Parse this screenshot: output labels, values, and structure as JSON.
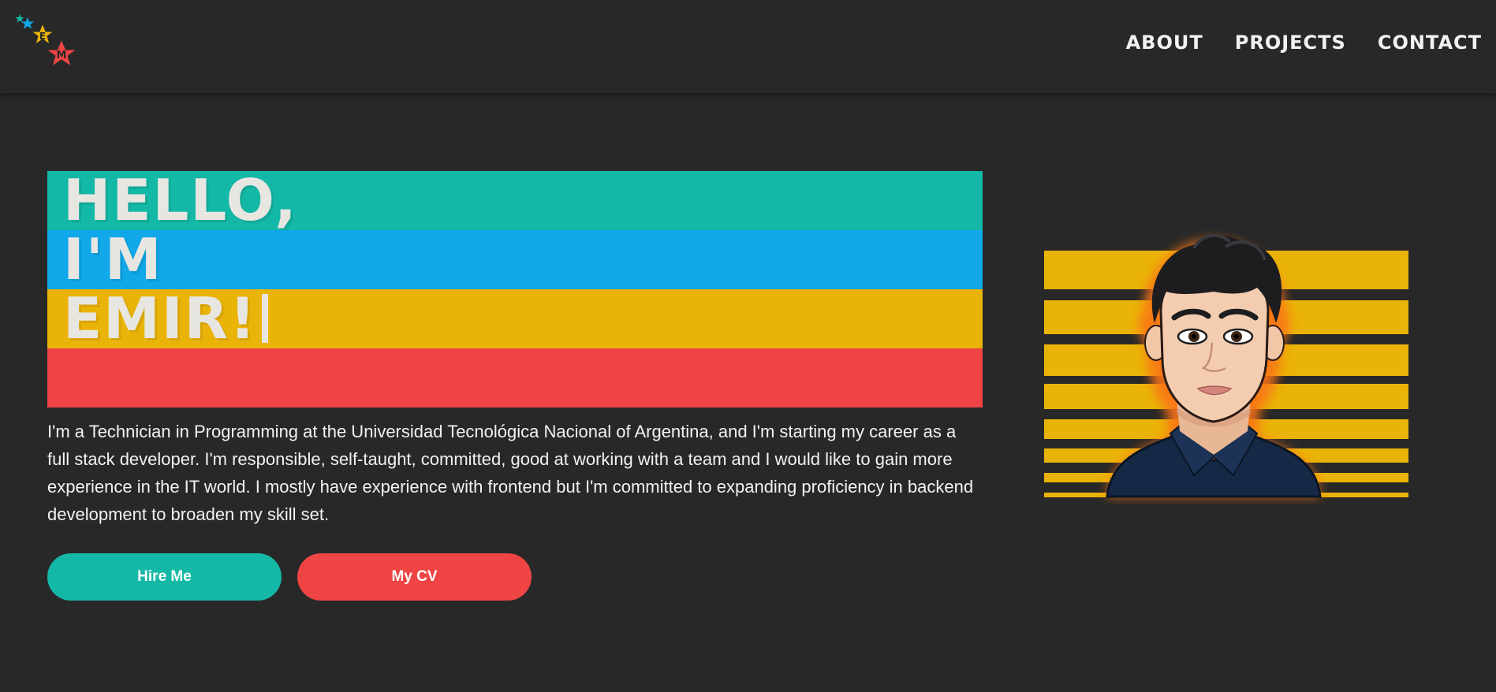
{
  "header": {
    "logo_letters": [
      "E",
      "M"
    ],
    "nav": [
      {
        "label": "ABOUT"
      },
      {
        "label": "PROJECTS"
      },
      {
        "label": "CONTACT"
      }
    ]
  },
  "hero": {
    "line1": "HELLO,",
    "line2": "I'M",
    "line3": "EMIR!",
    "intro": "I'm a Technician in Programming at the Universidad Tecnológica Nacional of Argentina, and I'm starting my career as a full stack developer. I'm responsible, self-taught, committed, good at working with a team and I would like to gain more experience in the IT world. I mostly have experience with frontend but I'm committed to expanding proficiency in backend development to broaden my skill set.",
    "buttons": {
      "hire": "Hire Me",
      "cv": "My CV"
    }
  },
  "colors": {
    "background": "#282828",
    "teal": "#14b8a6",
    "blue": "#10a8e8",
    "yellow": "#eab308",
    "red": "#ef4444",
    "text": "#f2f2f2"
  }
}
